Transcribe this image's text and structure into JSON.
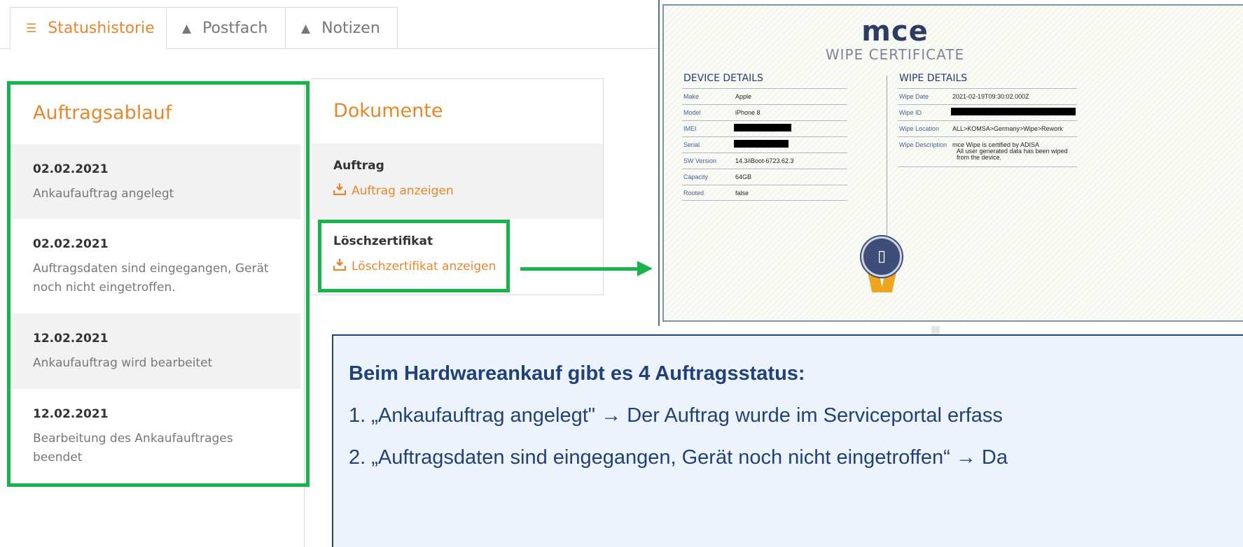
{
  "tabs": [
    {
      "label": "Statushistorie",
      "icon": "list-icon",
      "active": true
    },
    {
      "label": "Postfach",
      "icon": "warning-icon",
      "active": false
    },
    {
      "label": "Notizen",
      "icon": "warning-icon",
      "active": false
    }
  ],
  "timeline": {
    "title": "Auftragsablauf",
    "entries": [
      {
        "date": "02.02.2021",
        "desc": "Ankaufauftrag angelegt"
      },
      {
        "date": "02.02.2021",
        "desc": "Auftragsdaten sind eingegangen, Gerät noch nicht eingetroffen."
      },
      {
        "date": "12.02.2021",
        "desc": "Ankaufauftrag wird bearbeitet"
      },
      {
        "date": "12.02.2021",
        "desc": "Bearbeitung des Ankaufauftrages beendet"
      }
    ]
  },
  "documents": {
    "title": "Dokumente",
    "order": {
      "heading": "Auftrag",
      "link": "Auftrag anzeigen"
    },
    "certificate": {
      "heading": "Löschzertifikat",
      "link": "Löschzertifikat anzeigen"
    }
  },
  "cert": {
    "logo": "mce",
    "subtitle": "WIPE CERTIFICATE",
    "device_heading": "DEVICE DETAILS",
    "wipe_heading": "WIPE DETAILS",
    "device_rows": [
      {
        "key": "Make",
        "value": "Apple"
      },
      {
        "key": "Model",
        "value": "iPhone 8"
      },
      {
        "key": "IMEI",
        "value": ""
      },
      {
        "key": "Serial",
        "value": ""
      },
      {
        "key": "SW Version",
        "value": "14.3/iBoot-6723.62.3"
      },
      {
        "key": "Capacity",
        "value": "64GB"
      },
      {
        "key": "Rooted",
        "value": "false"
      }
    ],
    "wipe_rows": [
      {
        "key": "Wipe Date",
        "value": "2021-02-19T09:30:02.000Z"
      },
      {
        "key": "Wipe ID",
        "value": ""
      },
      {
        "key": "Wipe Location",
        "value": "ALL>KOMSA>Germany>Wipe>Rework"
      },
      {
        "key": "Wipe Description",
        "value": "mce Wipe is certified by ADISA",
        "value2": "All user generated data has been wiped",
        "value3": "from the device."
      }
    ]
  },
  "info": {
    "title": "Beim Hardwareankauf gibt es 4 Auftragsstatus:",
    "line1": "1. „Ankaufauftrag angelegt\" → Der Auftrag wurde im Serviceportal erfass",
    "line2": "2. „Auftragsdaten sind eingegangen, Gerät noch nicht eingetroffen“ → Da"
  },
  "colors": {
    "accent": "#e8862b",
    "highlight": "#19b24b",
    "navy": "#20417a"
  }
}
